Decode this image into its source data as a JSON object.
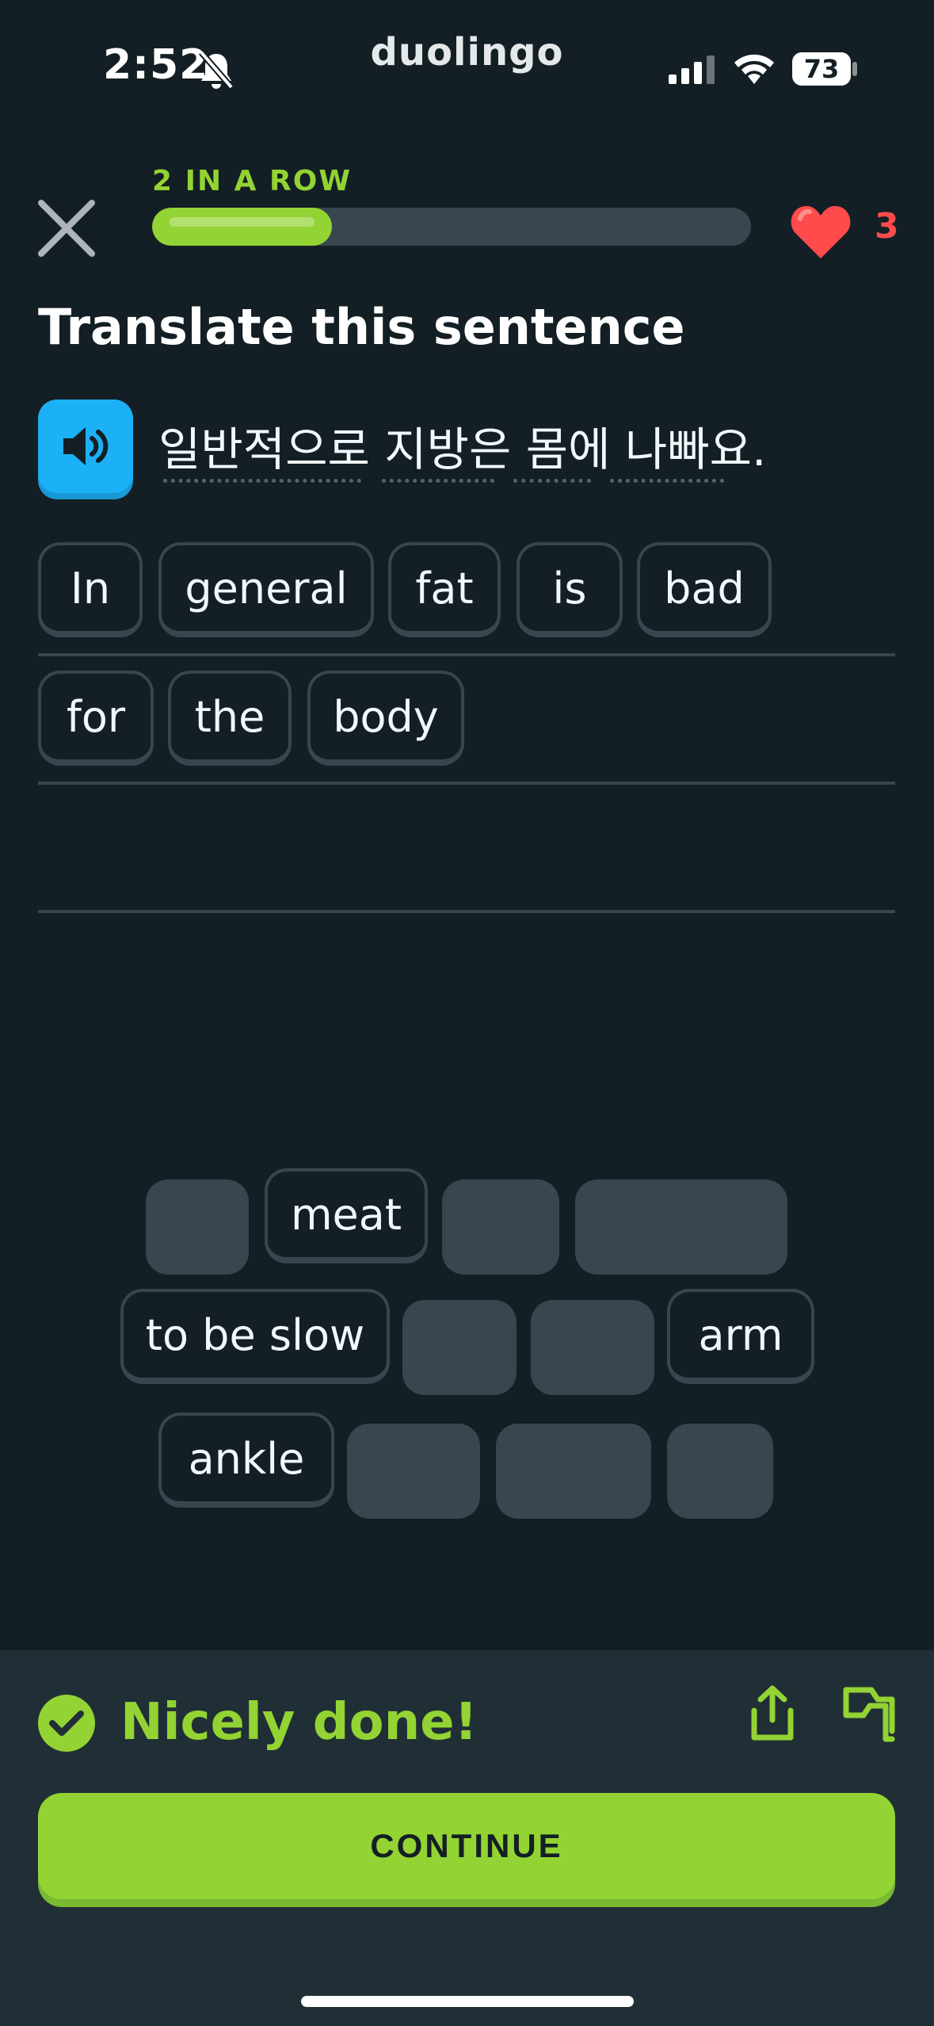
{
  "status_bar": {
    "time": "2:52",
    "app_name": "duolingo",
    "battery": "73",
    "icons": [
      "bell-slash-icon",
      "cellular-signal-icon",
      "wifi-icon",
      "battery-icon"
    ]
  },
  "header": {
    "streak_label": "2 IN A ROW",
    "progress_fraction": 0.3,
    "hearts": "3",
    "colors": {
      "progress": "#93d333",
      "heart": "#ff4b4b"
    }
  },
  "prompt": {
    "title": "Translate this sentence",
    "sentence": "일반적으로 지방은 몸에 나빠요.",
    "words": [
      "일반적으로",
      "지방은",
      "몸에",
      "나빠요."
    ]
  },
  "answer": {
    "tiles": [
      "In",
      "general",
      "fat",
      "is",
      "bad",
      "for",
      "the",
      "body"
    ]
  },
  "word_bank": {
    "tiles": [
      "meat",
      "to be slow",
      "arm",
      "ankle"
    ]
  },
  "feedback": {
    "message": "Nicely done!",
    "continue_label": "CONTINUE",
    "colors": {
      "success": "#93d333",
      "footer_bg": "#202f36"
    }
  }
}
